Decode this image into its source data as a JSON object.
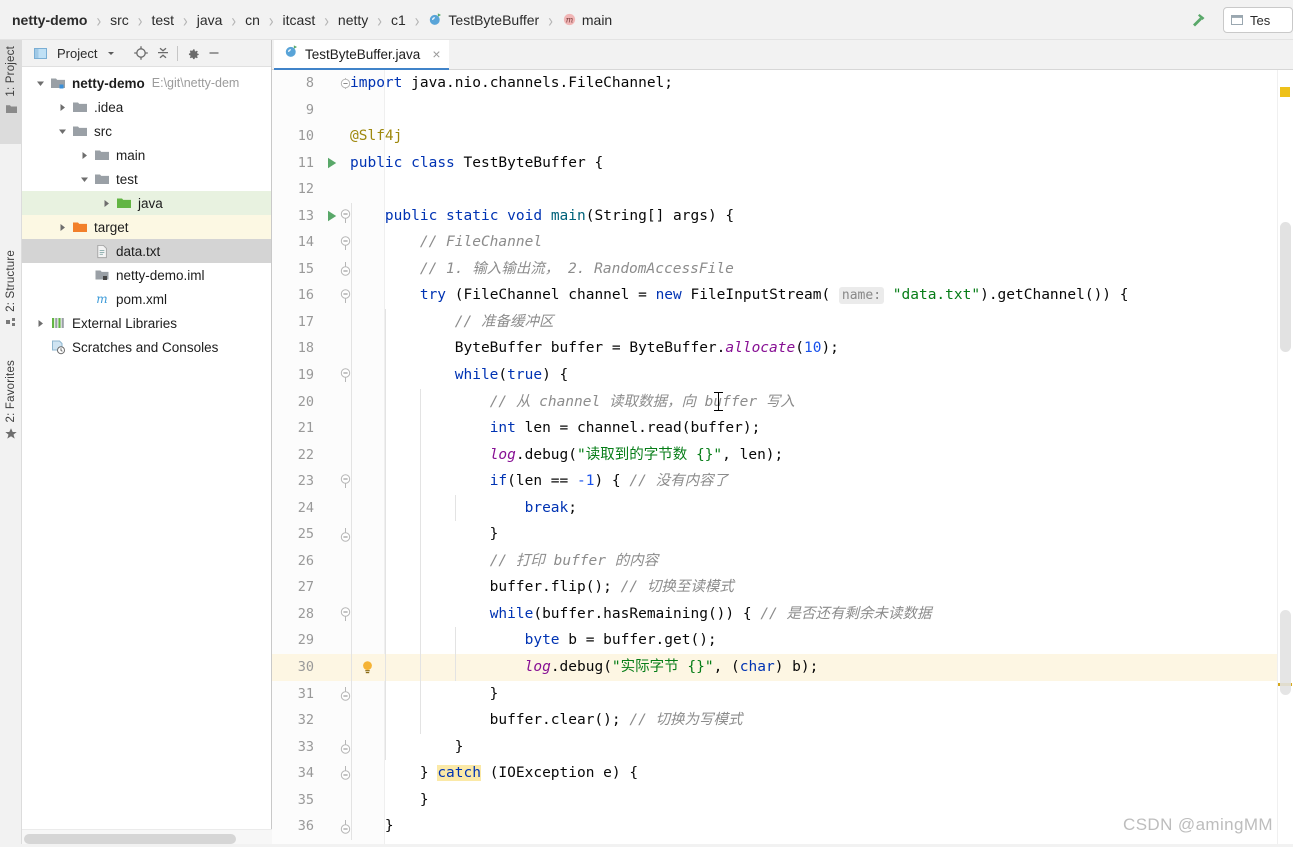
{
  "navbar": {
    "crumbs": [
      {
        "label": "netty-demo",
        "bold": true,
        "icon": ""
      },
      {
        "label": "src",
        "bold": false,
        "icon": ""
      },
      {
        "label": "test",
        "bold": false,
        "icon": ""
      },
      {
        "label": "java",
        "bold": false,
        "icon": ""
      },
      {
        "label": "cn",
        "bold": false,
        "icon": ""
      },
      {
        "label": "itcast",
        "bold": false,
        "icon": ""
      },
      {
        "label": "netty",
        "bold": false,
        "icon": ""
      },
      {
        "label": "c1",
        "bold": false,
        "icon": ""
      },
      {
        "label": "TestByteBuffer",
        "bold": false,
        "icon": "java-class-icon"
      },
      {
        "label": "main",
        "bold": false,
        "icon": "java-method-icon"
      }
    ],
    "separator": "›",
    "build_button": "hammer-icon",
    "run_config_label": "Tes"
  },
  "left_strip": {
    "tabs": [
      {
        "label": "1: Project",
        "icon": "folder-icon",
        "active": true
      },
      {
        "label": "2: Structure",
        "icon": "structure-icon",
        "active": false
      },
      {
        "label": "2: Favorites",
        "icon": "star-icon",
        "active": false
      }
    ]
  },
  "project_panel": {
    "title": "Project",
    "dropdown": "chevron-down-icon",
    "toolbar_icons": [
      "locate-icon",
      "collapse-all-icon",
      "gear-icon",
      "hide-icon"
    ],
    "tree": [
      {
        "indent": 0,
        "arrow": "down",
        "icon": "module-icon",
        "label": "netty-demo",
        "bold": true,
        "sub": "E:\\git\\netty-dem",
        "state": "none"
      },
      {
        "indent": 1,
        "arrow": "right",
        "icon": "folder-icon",
        "label": ".idea",
        "bold": false,
        "sub": "",
        "state": "none"
      },
      {
        "indent": 1,
        "arrow": "down",
        "icon": "folder-icon",
        "label": "src",
        "bold": false,
        "sub": "",
        "state": "none"
      },
      {
        "indent": 2,
        "arrow": "right",
        "icon": "folder-icon",
        "label": "main",
        "bold": false,
        "sub": "",
        "state": "none"
      },
      {
        "indent": 2,
        "arrow": "down",
        "icon": "folder-icon",
        "label": "test",
        "bold": false,
        "sub": "",
        "state": "none"
      },
      {
        "indent": 3,
        "arrow": "right",
        "icon": "source-root-icon",
        "label": "java",
        "bold": false,
        "sub": "",
        "state": "green"
      },
      {
        "indent": 1,
        "arrow": "right",
        "icon": "target-folder-icon",
        "label": "target",
        "bold": false,
        "sub": "",
        "state": "yellow"
      },
      {
        "indent": 2,
        "arrow": "none",
        "icon": "text-file-icon",
        "label": "data.txt",
        "bold": false,
        "sub": "",
        "state": "grey"
      },
      {
        "indent": 2,
        "arrow": "none",
        "icon": "iml-file-icon",
        "label": "netty-demo.iml",
        "bold": false,
        "sub": "",
        "state": "none"
      },
      {
        "indent": 2,
        "arrow": "none",
        "icon": "maven-icon",
        "label": "pom.xml",
        "bold": false,
        "sub": "",
        "state": "none"
      },
      {
        "indent": 0,
        "arrow": "right",
        "icon": "libraries-icon",
        "label": "External Libraries",
        "bold": false,
        "sub": "",
        "state": "none"
      },
      {
        "indent": 0,
        "arrow": "none",
        "icon": "scratches-icon",
        "label": "Scratches and Consoles",
        "bold": false,
        "sub": "",
        "state": "none"
      }
    ]
  },
  "editor": {
    "tab": {
      "name": "TestByteBuffer.java",
      "icon": "java-class-icon",
      "close": "×"
    },
    "first_line_number": 8,
    "highlighted_line": 30,
    "lines": [
      {
        "n": 8,
        "indent": 0,
        "fold": "start-top",
        "run": false,
        "bulb": false,
        "tokens": [
          {
            "t": "import",
            "c": "kw"
          },
          {
            "t": " java.nio.channels.FileChannel;",
            "c": "typ"
          }
        ]
      },
      {
        "n": 9,
        "indent": 0,
        "fold": "none",
        "run": false,
        "bulb": false,
        "tokens": []
      },
      {
        "n": 10,
        "indent": 0,
        "fold": "none",
        "run": false,
        "bulb": false,
        "tokens": [
          {
            "t": "@Slf4j",
            "c": "ann"
          }
        ]
      },
      {
        "n": 11,
        "indent": 0,
        "fold": "none",
        "run": true,
        "bulb": false,
        "tokens": [
          {
            "t": "public",
            "c": "kw"
          },
          {
            "t": " ",
            "c": "typ"
          },
          {
            "t": "class",
            "c": "kw"
          },
          {
            "t": " TestByteBuffer {",
            "c": "typ"
          }
        ]
      },
      {
        "n": 12,
        "indent": 0,
        "fold": "none",
        "run": false,
        "bulb": false,
        "tokens": []
      },
      {
        "n": 13,
        "indent": 1,
        "fold": "start",
        "run": true,
        "bulb": false,
        "tokens": [
          {
            "t": "    ",
            "c": "typ"
          },
          {
            "t": "public",
            "c": "kw"
          },
          {
            "t": " ",
            "c": "typ"
          },
          {
            "t": "static",
            "c": "kw"
          },
          {
            "t": " ",
            "c": "typ"
          },
          {
            "t": "void",
            "c": "kw"
          },
          {
            "t": " ",
            "c": "typ"
          },
          {
            "t": "main",
            "c": "mth"
          },
          {
            "t": "(String[] args) {",
            "c": "typ"
          }
        ]
      },
      {
        "n": 14,
        "indent": 1,
        "fold": "start",
        "run": false,
        "bulb": false,
        "tokens": [
          {
            "t": "        ",
            "c": "typ"
          },
          {
            "t": "// FileChannel",
            "c": "cmt"
          }
        ]
      },
      {
        "n": 15,
        "indent": 1,
        "fold": "end",
        "run": false,
        "bulb": false,
        "tokens": [
          {
            "t": "        ",
            "c": "typ"
          },
          {
            "t": "// 1. 输入输出流， 2. RandomAccessFile",
            "c": "cmt"
          }
        ]
      },
      {
        "n": 16,
        "indent": 1,
        "fold": "start",
        "run": false,
        "bulb": false,
        "tokens": [
          {
            "t": "        ",
            "c": "typ"
          },
          {
            "t": "try",
            "c": "kw"
          },
          {
            "t": " (FileChannel channel = ",
            "c": "typ"
          },
          {
            "t": "new",
            "c": "kw"
          },
          {
            "t": " FileInputStream( ",
            "c": "typ"
          },
          {
            "t": "name:",
            "c": "hint"
          },
          {
            "t": " ",
            "c": "typ"
          },
          {
            "t": "\"data.txt\"",
            "c": "str"
          },
          {
            "t": ").getChannel()) {",
            "c": "typ"
          }
        ]
      },
      {
        "n": 17,
        "indent": 2,
        "fold": "none",
        "run": false,
        "bulb": false,
        "tokens": [
          {
            "t": "            ",
            "c": "typ"
          },
          {
            "t": "// 准备缓冲区",
            "c": "cmt"
          }
        ]
      },
      {
        "n": 18,
        "indent": 2,
        "fold": "none",
        "run": false,
        "bulb": false,
        "tokens": [
          {
            "t": "            ByteBuffer buffer = ByteBuffer.",
            "c": "typ"
          },
          {
            "t": "allocate",
            "c": "fld"
          },
          {
            "t": "(",
            "c": "typ"
          },
          {
            "t": "10",
            "c": "num2"
          },
          {
            "t": ");",
            "c": "typ"
          }
        ]
      },
      {
        "n": 19,
        "indent": 2,
        "fold": "start",
        "run": false,
        "bulb": false,
        "tokens": [
          {
            "t": "            ",
            "c": "typ"
          },
          {
            "t": "while",
            "c": "kw"
          },
          {
            "t": "(",
            "c": "typ"
          },
          {
            "t": "true",
            "c": "kw"
          },
          {
            "t": ") {",
            "c": "typ"
          }
        ]
      },
      {
        "n": 20,
        "indent": 3,
        "fold": "none",
        "run": false,
        "bulb": false,
        "tokens": [
          {
            "t": "                ",
            "c": "typ"
          },
          {
            "t": "// 从 channel 读取数据，向 buffer 写入",
            "c": "cmt"
          }
        ]
      },
      {
        "n": 21,
        "indent": 3,
        "fold": "none",
        "run": false,
        "bulb": false,
        "tokens": [
          {
            "t": "                ",
            "c": "typ"
          },
          {
            "t": "int",
            "c": "kw"
          },
          {
            "t": " len = channel.read(buffer);",
            "c": "typ"
          }
        ]
      },
      {
        "n": 22,
        "indent": 3,
        "fold": "none",
        "run": false,
        "bulb": false,
        "tokens": [
          {
            "t": "                ",
            "c": "typ"
          },
          {
            "t": "log",
            "c": "fld"
          },
          {
            "t": ".debug(",
            "c": "typ"
          },
          {
            "t": "\"读取到的字节数 {}\"",
            "c": "str"
          },
          {
            "t": ", len);",
            "c": "typ"
          }
        ]
      },
      {
        "n": 23,
        "indent": 3,
        "fold": "start",
        "run": false,
        "bulb": false,
        "tokens": [
          {
            "t": "                ",
            "c": "typ"
          },
          {
            "t": "if",
            "c": "kw"
          },
          {
            "t": "(len == ",
            "c": "typ"
          },
          {
            "t": "-1",
            "c": "num2"
          },
          {
            "t": ") { ",
            "c": "typ"
          },
          {
            "t": "// 没有内容了",
            "c": "cmt"
          }
        ]
      },
      {
        "n": 24,
        "indent": 4,
        "fold": "none",
        "run": false,
        "bulb": false,
        "tokens": [
          {
            "t": "                    ",
            "c": "typ"
          },
          {
            "t": "break",
            "c": "kw"
          },
          {
            "t": ";",
            "c": "typ"
          }
        ]
      },
      {
        "n": 25,
        "indent": 3,
        "fold": "end",
        "run": false,
        "bulb": false,
        "tokens": [
          {
            "t": "                }",
            "c": "typ"
          }
        ]
      },
      {
        "n": 26,
        "indent": 3,
        "fold": "none",
        "run": false,
        "bulb": false,
        "tokens": [
          {
            "t": "                ",
            "c": "typ"
          },
          {
            "t": "// 打印 buffer 的内容",
            "c": "cmt"
          }
        ]
      },
      {
        "n": 27,
        "indent": 3,
        "fold": "none",
        "run": false,
        "bulb": false,
        "tokens": [
          {
            "t": "                buffer.flip(); ",
            "c": "typ"
          },
          {
            "t": "// 切换至读模式",
            "c": "cmt"
          }
        ]
      },
      {
        "n": 28,
        "indent": 3,
        "fold": "start",
        "run": false,
        "bulb": false,
        "tokens": [
          {
            "t": "                ",
            "c": "typ"
          },
          {
            "t": "while",
            "c": "kw"
          },
          {
            "t": "(buffer.hasRemaining()) { ",
            "c": "typ"
          },
          {
            "t": "// 是否还有剩余未读数据",
            "c": "cmt"
          }
        ]
      },
      {
        "n": 29,
        "indent": 4,
        "fold": "none",
        "run": false,
        "bulb": false,
        "tokens": [
          {
            "t": "                    ",
            "c": "typ"
          },
          {
            "t": "byte",
            "c": "kw"
          },
          {
            "t": " b = buffer.get();",
            "c": "typ"
          }
        ]
      },
      {
        "n": 30,
        "indent": 4,
        "fold": "none",
        "run": false,
        "bulb": true,
        "tokens": [
          {
            "t": "                    ",
            "c": "typ"
          },
          {
            "t": "log",
            "c": "fld"
          },
          {
            "t": ".debug(",
            "c": "typ"
          },
          {
            "t": "\"实际字节 {}\"",
            "c": "str"
          },
          {
            "t": ", (",
            "c": "typ"
          },
          {
            "t": "char",
            "c": "kw"
          },
          {
            "t": ") b);",
            "c": "typ"
          }
        ]
      },
      {
        "n": 31,
        "indent": 3,
        "fold": "end",
        "run": false,
        "bulb": false,
        "tokens": [
          {
            "t": "                }",
            "c": "typ"
          }
        ]
      },
      {
        "n": 32,
        "indent": 3,
        "fold": "none",
        "run": false,
        "bulb": false,
        "tokens": [
          {
            "t": "                buffer.clear(); ",
            "c": "typ"
          },
          {
            "t": "// 切换为写模式",
            "c": "cmt"
          }
        ]
      },
      {
        "n": 33,
        "indent": 2,
        "fold": "end",
        "run": false,
        "bulb": false,
        "tokens": [
          {
            "t": "            }",
            "c": "typ"
          }
        ]
      },
      {
        "n": 34,
        "indent": 1,
        "fold": "end",
        "run": false,
        "bulb": false,
        "tokens": [
          {
            "t": "        } ",
            "c": "typ"
          },
          {
            "t": "catch",
            "c": "kw catchhl"
          },
          {
            "t": " (IOException e) {",
            "c": "typ"
          }
        ]
      },
      {
        "n": 35,
        "indent": 1,
        "fold": "none",
        "run": false,
        "bulb": false,
        "tokens": [
          {
            "t": "        }",
            "c": "typ"
          }
        ]
      },
      {
        "n": 36,
        "indent": 1,
        "fold": "end",
        "run": false,
        "bulb": false,
        "tokens": [
          {
            "t": "    }",
            "c": "typ"
          }
        ]
      }
    ]
  },
  "watermark": "CSDN @amingMM",
  "colors": {
    "accent": "#4083c9",
    "keyword": "#0033b3",
    "string": "#067d17",
    "comment": "#8c8c8c",
    "annotation": "#9e880d",
    "field": "#871094",
    "number": "#1750eb",
    "warning_marker": "#eec11a",
    "selection_grey": "#d4d4d4",
    "source_green": "#e8f2e0",
    "target_yellow": "#fcf8e3"
  }
}
